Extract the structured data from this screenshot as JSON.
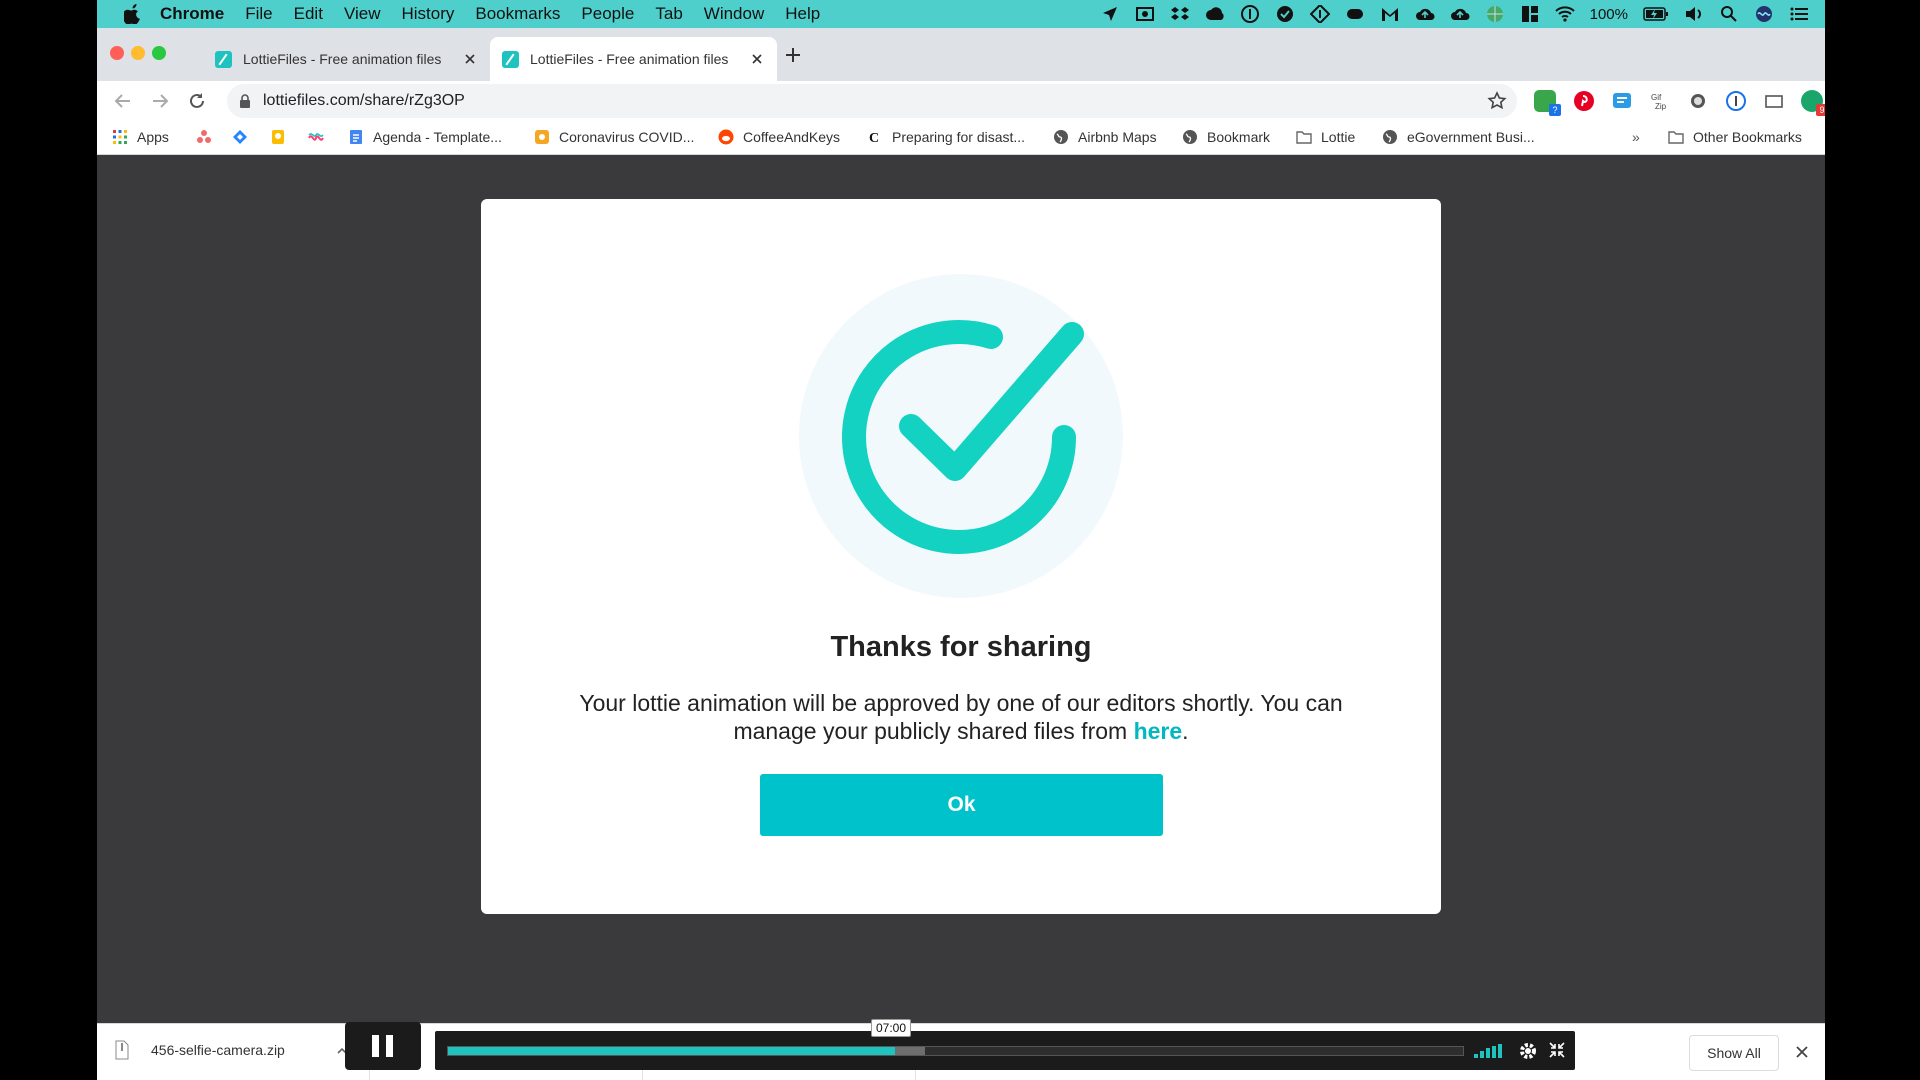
{
  "menubar": {
    "app_name": "Chrome",
    "menus": [
      "File",
      "Edit",
      "View",
      "History",
      "Bookmarks",
      "People",
      "Tab",
      "Window",
      "Help"
    ],
    "battery_percent": "100%"
  },
  "tabs": [
    {
      "title": "LottieFiles - Free animation files",
      "active": false
    },
    {
      "title": "LottieFiles - Free animation files",
      "active": true
    }
  ],
  "toolbar": {
    "url": "lottiefiles.com/share/rZg3OP"
  },
  "bookmarks": {
    "items": [
      {
        "label": "Apps",
        "icon": "apps-grid-icon"
      },
      {
        "label": "",
        "icon": "asana-icon"
      },
      {
        "label": "",
        "icon": "jira-icon"
      },
      {
        "label": "",
        "icon": "keep-icon"
      },
      {
        "label": "",
        "icon": "wave-icon"
      },
      {
        "label": "Agenda - Template...",
        "icon": "docs-icon"
      },
      {
        "label": "Coronavirus COVID...",
        "icon": "coronavirus-icon"
      },
      {
        "label": "CoffeeAndKeys",
        "icon": "reddit-icon"
      },
      {
        "label": "Preparing for disast...",
        "icon": "nyt-icon"
      },
      {
        "label": "Airbnb Maps",
        "icon": "globe-icon"
      },
      {
        "label": "Bookmark",
        "icon": "globe-icon"
      },
      {
        "label": "Lottie",
        "icon": "folder-icon"
      },
      {
        "label": "eGovernment Busi...",
        "icon": "globe-icon"
      }
    ],
    "overflow": "»",
    "other": "Other Bookmarks"
  },
  "modal": {
    "title": "Thanks for sharing",
    "body_prefix": "Your lottie animation will be approved by one of our editors shortly. You can manage your publicly shared files from ",
    "body_link": "here",
    "body_suffix": ".",
    "ok_label": "Ok"
  },
  "downloads": {
    "filename": "456-selfie-camera.zip",
    "show_all": "Show All"
  },
  "player": {
    "time": "07:00",
    "progress": 0.44,
    "buffered": 0.47
  },
  "colors": {
    "accent": "#00c2cb",
    "menubar": "#4ecfcb",
    "page_bg": "#3a393b"
  }
}
